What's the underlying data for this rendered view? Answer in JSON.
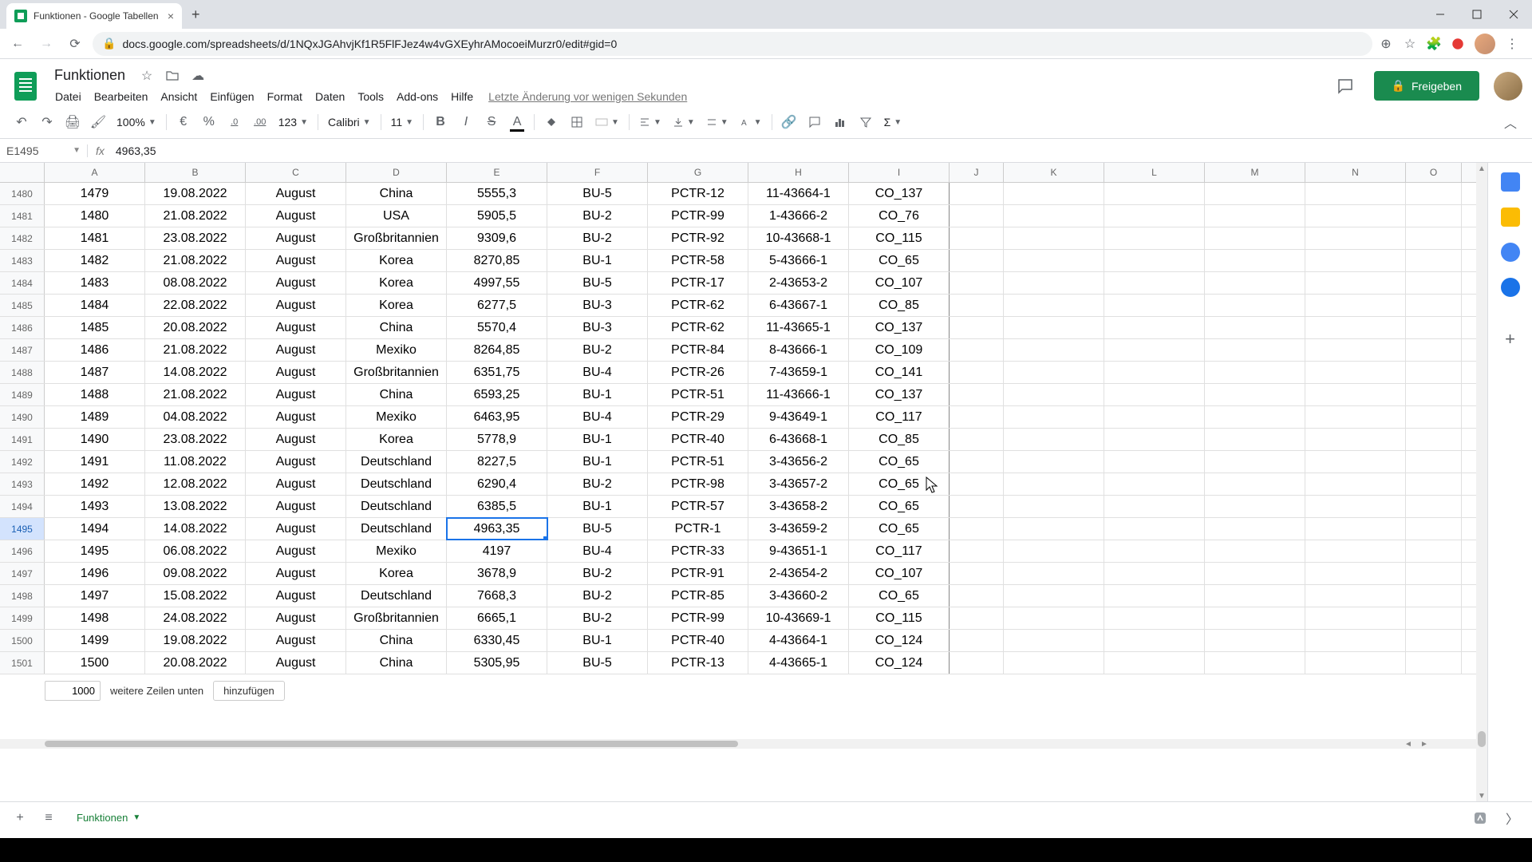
{
  "browser": {
    "tab_title": "Funktionen - Google Tabellen",
    "url": "docs.google.com/spreadsheets/d/1NQxJGAhvjKf1R5FlFJez4w4vGXEyhrAMocoeiMurzr0/edit#gid=0"
  },
  "doc": {
    "title": "Funktionen",
    "menus": [
      "Datei",
      "Bearbeiten",
      "Ansicht",
      "Einfügen",
      "Format",
      "Daten",
      "Tools",
      "Add-ons",
      "Hilfe"
    ],
    "last_edit": "Letzte Änderung vor wenigen Sekunden",
    "share_label": "Freigeben"
  },
  "toolbar": {
    "zoom": "100%",
    "currency": "€",
    "percent": "%",
    "dec_less": ".0",
    "dec_more": ".00",
    "numfmt": "123",
    "font": "Calibri",
    "size": "11"
  },
  "formula": {
    "name_box": "E1495",
    "value": "4963,35"
  },
  "columns": [
    "A",
    "B",
    "C",
    "D",
    "E",
    "F",
    "G",
    "H",
    "I",
    "J",
    "K",
    "L",
    "M",
    "N",
    "O"
  ],
  "col_widths": [
    "cA",
    "cB",
    "cC",
    "cD",
    "cE",
    "cF",
    "cG",
    "cH",
    "cI",
    "cJ",
    "cK",
    "cL",
    "cM",
    "cN",
    "cO"
  ],
  "selected_cell": {
    "row_idx": 15,
    "col_idx": 4
  },
  "rows": [
    {
      "h": "1480",
      "v": [
        "1479",
        "19.08.2022",
        "August",
        "China",
        "5555,3",
        "BU-5",
        "PCTR-12",
        "11-43664-1",
        "CO_137"
      ]
    },
    {
      "h": "1481",
      "v": [
        "1480",
        "21.08.2022",
        "August",
        "USA",
        "5905,5",
        "BU-2",
        "PCTR-99",
        "1-43666-2",
        "CO_76"
      ]
    },
    {
      "h": "1482",
      "v": [
        "1481",
        "23.08.2022",
        "August",
        "Großbritannien",
        "9309,6",
        "BU-2",
        "PCTR-92",
        "10-43668-1",
        "CO_115"
      ]
    },
    {
      "h": "1483",
      "v": [
        "1482",
        "21.08.2022",
        "August",
        "Korea",
        "8270,85",
        "BU-1",
        "PCTR-58",
        "5-43666-1",
        "CO_65"
      ]
    },
    {
      "h": "1484",
      "v": [
        "1483",
        "08.08.2022",
        "August",
        "Korea",
        "4997,55",
        "BU-5",
        "PCTR-17",
        "2-43653-2",
        "CO_107"
      ]
    },
    {
      "h": "1485",
      "v": [
        "1484",
        "22.08.2022",
        "August",
        "Korea",
        "6277,5",
        "BU-3",
        "PCTR-62",
        "6-43667-1",
        "CO_85"
      ]
    },
    {
      "h": "1486",
      "v": [
        "1485",
        "20.08.2022",
        "August",
        "China",
        "5570,4",
        "BU-3",
        "PCTR-62",
        "11-43665-1",
        "CO_137"
      ]
    },
    {
      "h": "1487",
      "v": [
        "1486",
        "21.08.2022",
        "August",
        "Mexiko",
        "8264,85",
        "BU-2",
        "PCTR-84",
        "8-43666-1",
        "CO_109"
      ]
    },
    {
      "h": "1488",
      "v": [
        "1487",
        "14.08.2022",
        "August",
        "Großbritannien",
        "6351,75",
        "BU-4",
        "PCTR-26",
        "7-43659-1",
        "CO_141"
      ]
    },
    {
      "h": "1489",
      "v": [
        "1488",
        "21.08.2022",
        "August",
        "China",
        "6593,25",
        "BU-1",
        "PCTR-51",
        "11-43666-1",
        "CO_137"
      ]
    },
    {
      "h": "1490",
      "v": [
        "1489",
        "04.08.2022",
        "August",
        "Mexiko",
        "6463,95",
        "BU-4",
        "PCTR-29",
        "9-43649-1",
        "CO_117"
      ]
    },
    {
      "h": "1491",
      "v": [
        "1490",
        "23.08.2022",
        "August",
        "Korea",
        "5778,9",
        "BU-1",
        "PCTR-40",
        "6-43668-1",
        "CO_85"
      ]
    },
    {
      "h": "1492",
      "v": [
        "1491",
        "11.08.2022",
        "August",
        "Deutschland",
        "8227,5",
        "BU-1",
        "PCTR-51",
        "3-43656-2",
        "CO_65"
      ]
    },
    {
      "h": "1493",
      "v": [
        "1492",
        "12.08.2022",
        "August",
        "Deutschland",
        "6290,4",
        "BU-2",
        "PCTR-98",
        "3-43657-2",
        "CO_65"
      ]
    },
    {
      "h": "1494",
      "v": [
        "1493",
        "13.08.2022",
        "August",
        "Deutschland",
        "6385,5",
        "BU-1",
        "PCTR-57",
        "3-43658-2",
        "CO_65"
      ]
    },
    {
      "h": "1495",
      "v": [
        "1494",
        "14.08.2022",
        "August",
        "Deutschland",
        "4963,35",
        "BU-5",
        "PCTR-1",
        "3-43659-2",
        "CO_65"
      ]
    },
    {
      "h": "1496",
      "v": [
        "1495",
        "06.08.2022",
        "August",
        "Mexiko",
        "4197",
        "BU-4",
        "PCTR-33",
        "9-43651-1",
        "CO_117"
      ]
    },
    {
      "h": "1497",
      "v": [
        "1496",
        "09.08.2022",
        "August",
        "Korea",
        "3678,9",
        "BU-2",
        "PCTR-91",
        "2-43654-2",
        "CO_107"
      ]
    },
    {
      "h": "1498",
      "v": [
        "1497",
        "15.08.2022",
        "August",
        "Deutschland",
        "7668,3",
        "BU-2",
        "PCTR-85",
        "3-43660-2",
        "CO_65"
      ]
    },
    {
      "h": "1499",
      "v": [
        "1498",
        "24.08.2022",
        "August",
        "Großbritannien",
        "6665,1",
        "BU-2",
        "PCTR-99",
        "10-43669-1",
        "CO_115"
      ]
    },
    {
      "h": "1500",
      "v": [
        "1499",
        "19.08.2022",
        "August",
        "China",
        "6330,45",
        "BU-1",
        "PCTR-40",
        "4-43664-1",
        "CO_124"
      ]
    },
    {
      "h": "1501",
      "v": [
        "1500",
        "20.08.2022",
        "August",
        "China",
        "5305,95",
        "BU-5",
        "PCTR-13",
        "4-43665-1",
        "CO_124"
      ]
    }
  ],
  "add_rows": {
    "count": "1000",
    "text": "weitere Zeilen unten",
    "button": "hinzufügen"
  },
  "sheet_tab": "Funktionen"
}
